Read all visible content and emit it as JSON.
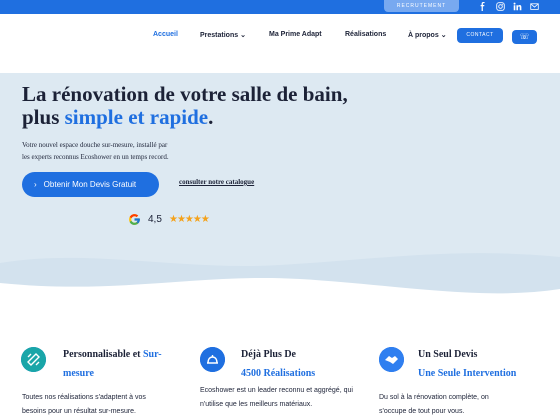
{
  "topbar": {
    "recruit_label": "RECRUTEMENT",
    "socials": [
      {
        "icon": "facebook-icon"
      },
      {
        "icon": "instagram-icon"
      },
      {
        "icon": "linkedin-icon"
      },
      {
        "icon": "mail-icon"
      }
    ]
  },
  "nav": {
    "items": [
      {
        "label": "Accueil",
        "active": true
      },
      {
        "label": "Prestations",
        "dropdown": true
      },
      {
        "label": "Ma Prime Adapt"
      },
      {
        "label": "Réalisations"
      },
      {
        "label": "À propos",
        "dropdown": true
      }
    ],
    "contact_label": "CONTACT",
    "phone_icon": "phone-icon"
  },
  "hero": {
    "title_line1": "La rénovation de votre salle de bain,",
    "title_line2_prefix": "plus ",
    "title_line2_accent": "simple et rapide",
    "title_line2_suffix": ".",
    "subtitle_line1": "Votre nouvel espace douche sur-mesure, installé par",
    "subtitle_line2": "les experts reconnus Ecoshower en un temps record.",
    "cta_label": "Obtenir Mon Devis Gratuit",
    "catalog_label": "consulter notre catalogue",
    "rating_value": "4,5",
    "rating_stars": 5
  },
  "features": [
    {
      "icon": "ruler-pencil-icon",
      "head_plain": "Personnalisable et ",
      "head_blue": "Sur-",
      "head_blue2": "mesure",
      "text1": "Toutes nos réalisations s'adaptent à vos",
      "text2": "besoins pour un résultat sur-mesure."
    },
    {
      "icon": "service-bell-icon",
      "head_plain": "Déjà Plus De",
      "head_blue": "4500 Réalisations",
      "text1": "Ecoshower est un leader reconnu et aggrégé, qui",
      "text2": "n'utilise que les meilleurs matériaux."
    },
    {
      "icon": "handshake-icon",
      "head_plain": "Un Seul Devis",
      "head_blue": "Une Seule Intervention",
      "text1": "Du sol à la rénovation complète, on",
      "text2": "s'occupe de tout pour vous."
    }
  ],
  "colors": {
    "brand_blue": "#1f6fe0",
    "hero_bg": "#dde9f2",
    "dark_text": "#1c2237",
    "star": "#f4a21c"
  }
}
